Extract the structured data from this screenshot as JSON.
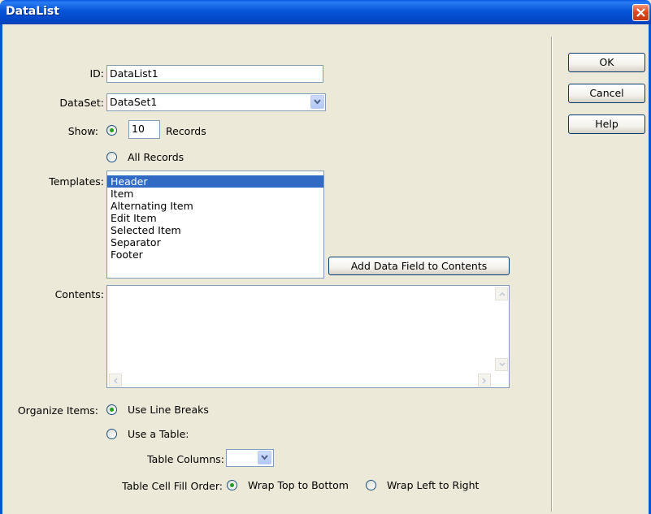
{
  "window": {
    "title": "DataList"
  },
  "fields": {
    "id_label": "ID:",
    "id_value": "DataList1",
    "dataset_label": "DataSet:",
    "dataset_value": "DataSet1",
    "show_label": "Show:",
    "records_count": "10",
    "records_label": "Records",
    "all_records_label": "All Records",
    "show_selected": "records",
    "templates_label": "Templates:",
    "templates": [
      "Header",
      "Item",
      "Alternating Item",
      "Edit Item",
      "Selected Item",
      "Separator",
      "Footer"
    ],
    "templates_selected": "Header",
    "add_data_field_label": "Add Data Field to Contents",
    "contents_label": "Contents:",
    "contents_value": "",
    "organize_label": "Organize Items:",
    "use_line_breaks_label": "Use Line Breaks",
    "use_table_label": "Use a Table:",
    "organize_selected": "line_breaks",
    "table_columns_label": "Table Columns:",
    "table_columns_value": "",
    "fill_order_label": "Table Cell Fill Order:",
    "wrap_top_bottom_label": "Wrap Top to Bottom",
    "wrap_left_right_label": "Wrap Left to Right",
    "fill_order_selected": "top_to_bottom"
  },
  "buttons": {
    "ok": "OK",
    "cancel": "Cancel",
    "help": "Help"
  },
  "colors": {
    "title_bar": "#0653d8",
    "dialog_bg": "#ece9d8",
    "selection": "#316ac5",
    "close": "#e0481c"
  }
}
